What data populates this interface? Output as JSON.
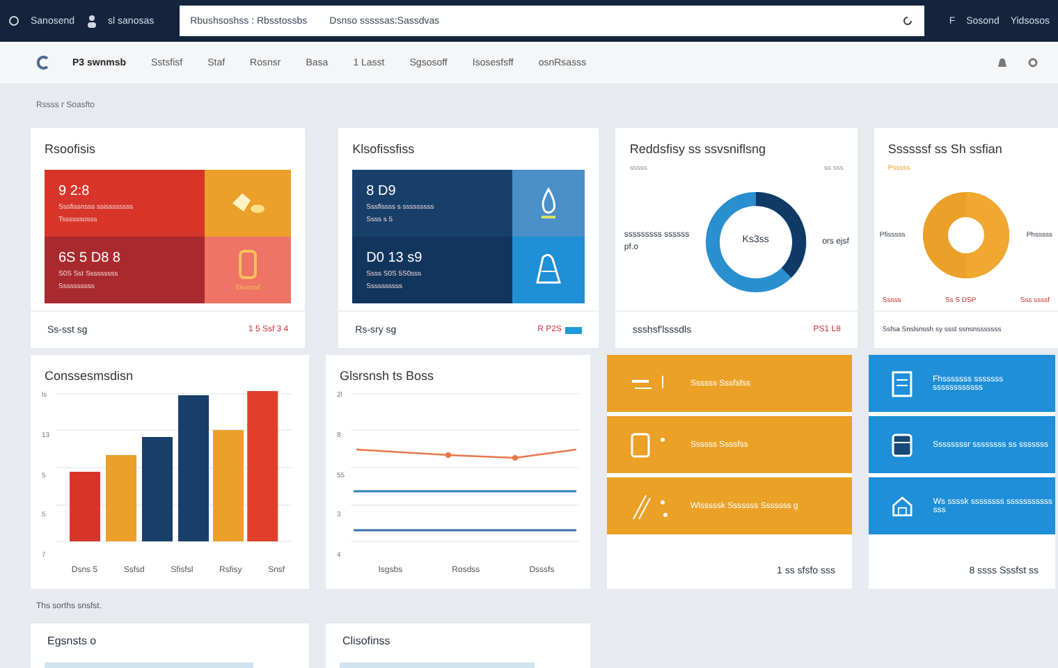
{
  "browser": {
    "tab_title": "Sanosend",
    "tab_2": "sl sanosas",
    "address_left": "Rbushsoshss : Rbsstossbs",
    "address_right": "Dsnso sssssas:Sassdvas",
    "right_items": [
      "F",
      "Sosond",
      "Yidsosos"
    ]
  },
  "nav": {
    "items": [
      {
        "label": "P3 swnmsb",
        "selected": true
      },
      {
        "label": "Sstsfisf",
        "selected": false
      },
      {
        "label": "Staf",
        "selected": false
      },
      {
        "label": "Rosnsr",
        "selected": false
      },
      {
        "label": "Basa",
        "selected": false
      },
      {
        "label": "1 Lasst",
        "selected": false
      },
      {
        "label": "Sgsosoff",
        "selected": false
      },
      {
        "label": "Isosesfsff",
        "selected": false
      },
      {
        "label": "osnRsasss",
        "selected": false
      }
    ]
  },
  "breadcrumb": "Rssss r Soasfto",
  "tile_cards": [
    {
      "title": "Rsoofisis",
      "tiles": [
        {
          "kind": "text",
          "color": "#d8352a",
          "value": "9 2:8",
          "line_1": "Sssfissnsss ssissssssss",
          "line_2": "Tssssssosss"
        },
        {
          "kind": "icon",
          "color": "#eba02a"
        },
        {
          "kind": "text",
          "color": "#a92a2e",
          "value": "6S 5 D8 8",
          "line_1": "S0S Sst Sssssssss",
          "line_2": "Ssssssssss"
        },
        {
          "kind": "icon",
          "color": "#ee7466",
          "caption": "Ekosssf"
        }
      ],
      "footer_left": "Ss-sst sg",
      "footer_right": "1 5 Ssf 3 4",
      "badge": false
    },
    {
      "title": "Klsofissfiss",
      "tiles": [
        {
          "kind": "text",
          "color": "#173f6a",
          "value": "8 D9",
          "line_1": "Sssfissss s sssssssss",
          "line_2": "Ssss s 5"
        },
        {
          "kind": "icon",
          "color": "#4a8fc8"
        },
        {
          "kind": "text",
          "color": "#12355d",
          "value": "D0 13 s9",
          "line_1": "Ssss S0S 5S0sss",
          "line_2": "Ssssssssss"
        },
        {
          "kind": "icon",
          "color": "#1f8fd6"
        }
      ],
      "footer_left": "Rs-sry sg",
      "footer_right": "R P2S",
      "badge": true
    }
  ],
  "donut_card": {
    "title": "Reddsfisy ss ssvsniflsng",
    "legend_left": "sssss",
    "legend_right": "ss sss",
    "label_left_1": "sssssssss ssssss",
    "label_left_2": "pf.o",
    "center": "Ks3ss",
    "label_right": "ors ejsf",
    "footer": "ssshsf'lsssdls",
    "footer_right": "PS1 L8"
  },
  "ring_card": {
    "title": "Ssssssf ss Sh ssfian",
    "legend": "Psssss",
    "label_left": "Pfisssss",
    "label_right": "Phsssss",
    "bottom_labels": [
      "Sssss",
      "Ss S DSP",
      "Sss ssssf"
    ],
    "footer": "Ssfsa Snslsnssh sy ssst ssnsnsssssss"
  },
  "bar_card": {
    "title": "Conssesmsdisn",
    "yticks": [
      "ls",
      "13",
      "5",
      "5",
      "7"
    ],
    "categories": [
      "Dsns 5",
      "Ssfsd",
      "Sfisfsl",
      "Rsfisy",
      "Snsf"
    ]
  },
  "line_card": {
    "title": "Glsrsnsh ts Boss",
    "yticks": [
      "2l",
      "8",
      "55",
      "3",
      "4"
    ],
    "categories": [
      "Isgsbs",
      "Rosdss",
      "Dsssfs"
    ]
  },
  "list_cards": [
    {
      "color": "#eaa126",
      "rows": [
        "Ssssss Sssfsfss",
        "Ssssss Ssssfss",
        "Wlsssssk Sssssss Sssssss g"
      ],
      "footer": "1 ss sfsfo sss"
    },
    {
      "color": "#1e8fd8",
      "rows": [
        "Fhsssssss sssssss ssssssssssss",
        "Ssssssssr ssssssss ss sssssss",
        "Ws ssssk ssssssss sssssssssss sss"
      ],
      "footer": "8 ssss Sssfst ss"
    }
  ],
  "note": "Ths sorths snsfst.",
  "bottom_cards": [
    "Egsnsts o",
    "Clisofinss"
  ]
}
